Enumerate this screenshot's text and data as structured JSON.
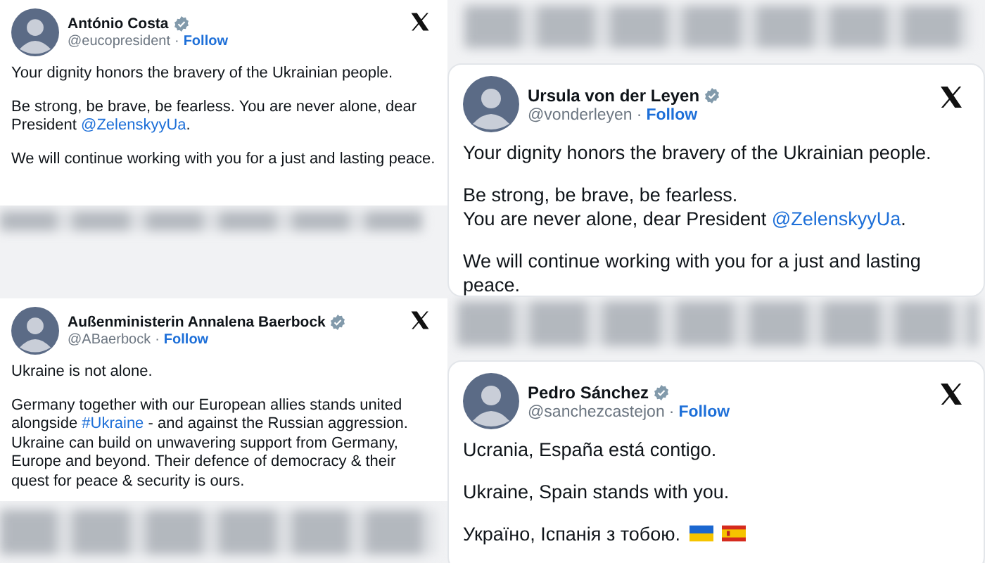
{
  "tweets": [
    {
      "name": "António Costa",
      "verified": true,
      "handle": "@eucopresident",
      "separator": "·",
      "follow": "Follow",
      "paragraphs": [
        [
          {
            "text": "Your dignity honors the bravery of the Ukrainian people."
          }
        ],
        [
          {
            "text": "Be strong, be brave, be fearless. You are never alone, dear President "
          },
          {
            "text": "@ZelenskyyUa",
            "kind": "link"
          },
          {
            "text": "."
          }
        ],
        [
          {
            "text": "We will continue working with you for a just and lasting peace."
          }
        ]
      ]
    },
    {
      "name": "Ursula von der Leyen",
      "verified": true,
      "handle": "@vonderleyen",
      "separator": "·",
      "follow": "Follow",
      "paragraphs": [
        [
          {
            "text": "Your dignity honors the bravery of the Ukrainian people."
          }
        ],
        [
          {
            "text": "Be strong, be brave, be fearless.\nYou are never alone, dear President "
          },
          {
            "text": "@ZelenskyyUa",
            "kind": "link"
          },
          {
            "text": "."
          }
        ],
        [
          {
            "text": "We will continue working with you for a just and lasting peace."
          }
        ]
      ]
    },
    {
      "name": "Außenministerin Annalena Baerbock",
      "verified": true,
      "handle": "@ABaerbock",
      "separator": "·",
      "follow": "Follow",
      "paragraphs": [
        [
          {
            "text": "Ukraine is not alone."
          }
        ],
        [
          {
            "text": "Germany together with our European allies stands united alongside "
          },
          {
            "text": "#Ukraine",
            "kind": "link"
          },
          {
            "text": " - and against the Russian aggression. Ukraine can build on unwavering support from Germany, Europe and beyond. Their defence of democracy & their quest for peace & security is ours."
          }
        ]
      ]
    },
    {
      "name": "Pedro Sánchez",
      "verified": true,
      "handle": "@sanchezcastejon",
      "separator": "·",
      "follow": "Follow",
      "paragraphs": [
        [
          {
            "text": "Ucrania, España está contigo."
          }
        ],
        [
          {
            "text": "Ukraine, Spain stands with you."
          }
        ],
        [
          {
            "text": "Україно, Іспанія з тобою."
          },
          {
            "kind": "ukraine-flag"
          },
          {
            "kind": "spain-flag"
          }
        ]
      ]
    }
  ]
}
